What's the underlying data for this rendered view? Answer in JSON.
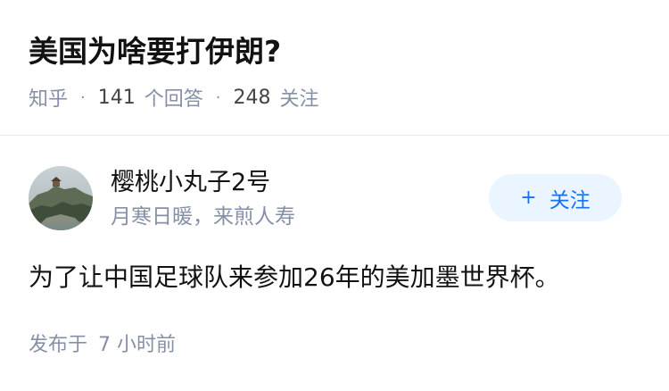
{
  "question": {
    "title": "美国为啥要打伊朗?",
    "source": "知乎",
    "answer_count": "141",
    "answer_label": "个回答",
    "follower_count": "248",
    "follower_label": "关注",
    "separator": "·"
  },
  "answer": {
    "author": {
      "name": "樱桃小丸子2号",
      "bio": "月寒日暖，来煎人寿",
      "avatar_icon": "landscape-photo-avatar"
    },
    "follow_button": {
      "plus": "+",
      "label": "关注"
    },
    "content": "为了让中国足球队来参加26年的美加墨世界杯。",
    "published_label": "发布于",
    "published_value": "7",
    "published_unit": "小时前"
  },
  "colors": {
    "accent": "#1772f6",
    "accent_bg": "#ebf5ff",
    "muted": "#8590a6",
    "text": "#121212"
  }
}
